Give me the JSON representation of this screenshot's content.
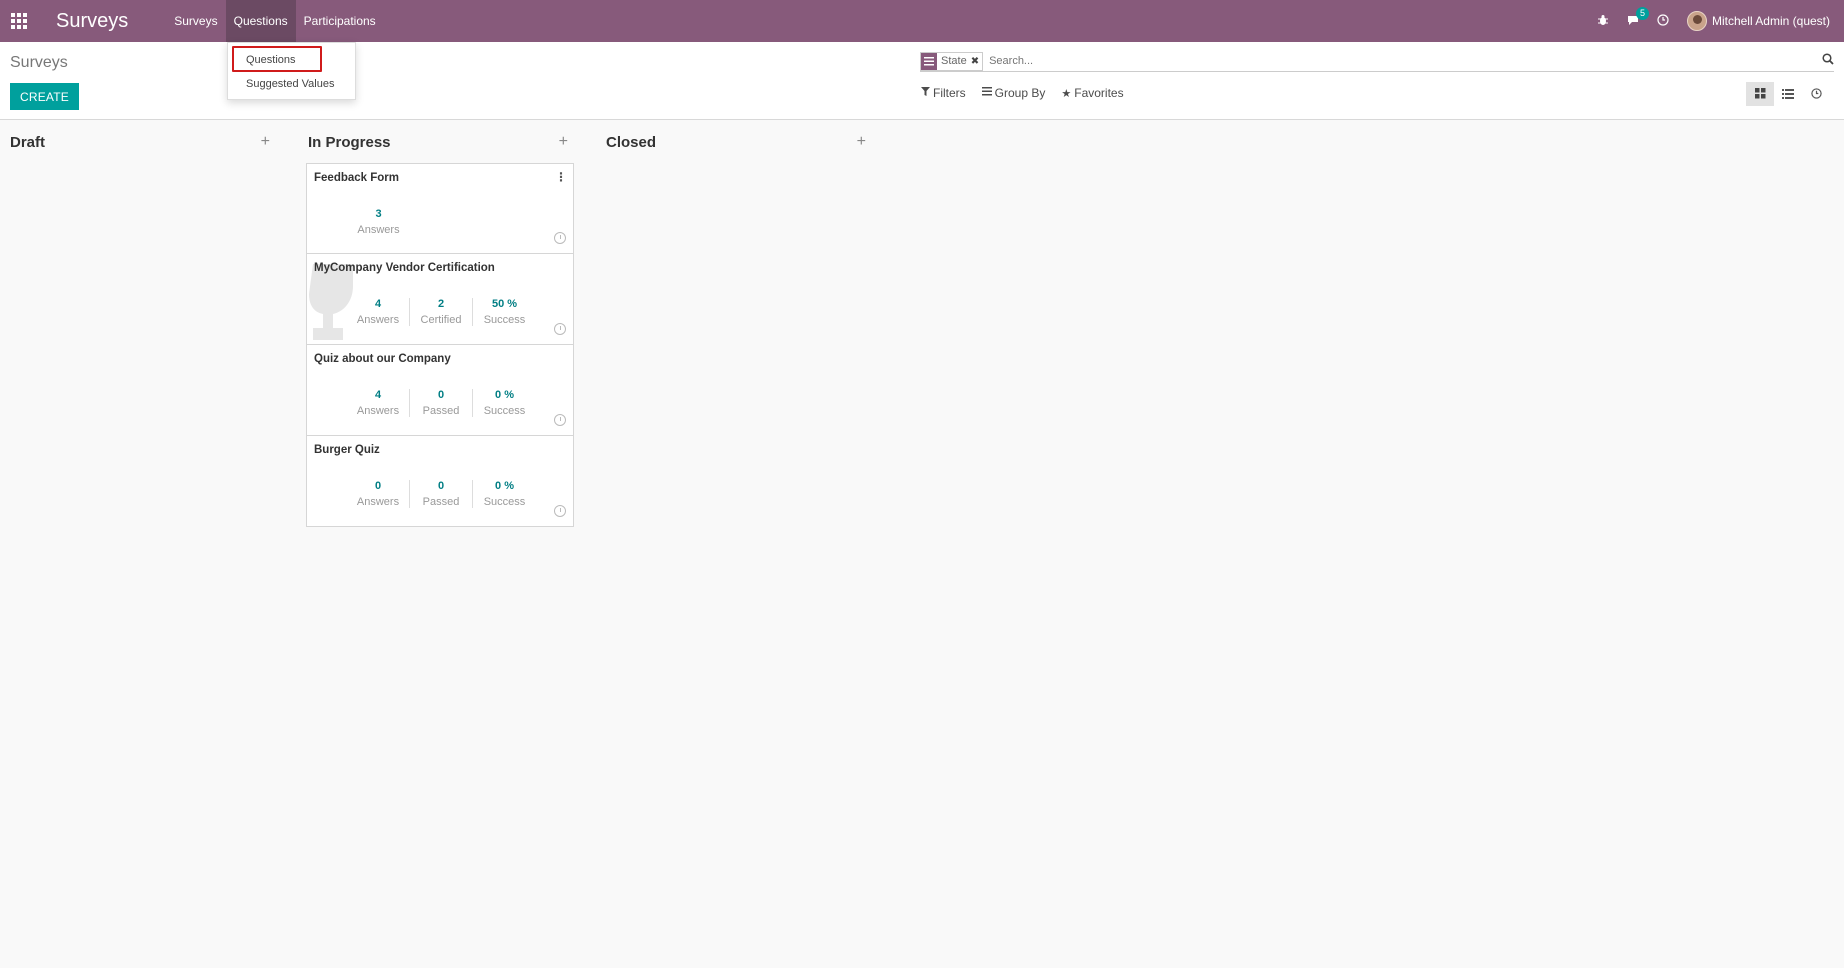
{
  "navbar": {
    "brand": "Surveys",
    "menu": [
      "Surveys",
      "Questions",
      "Participations"
    ],
    "active_menu": "Questions",
    "messages_count": "5",
    "user_name": "Mitchell Admin (quest)"
  },
  "dropdown": {
    "items": [
      "Questions",
      "Suggested Values"
    ],
    "highlighted": "Questions"
  },
  "control_panel": {
    "breadcrumb": "Surveys",
    "create_label": "CREATE",
    "search_facet": "State",
    "search_placeholder": "Search...",
    "filters_label": "Filters",
    "group_by_label": "Group By",
    "favorites_label": "Favorites"
  },
  "kanban": {
    "columns": [
      {
        "title": "Draft",
        "cards": []
      },
      {
        "title": "In Progress",
        "cards": [
          {
            "title": "Feedback Form",
            "stats": [
              {
                "value": "3",
                "label": "Answers"
              }
            ]
          },
          {
            "title": "MyCompany Vendor Certification",
            "stats": [
              {
                "value": "4",
                "label": "Answers"
              },
              {
                "value": "2",
                "label": "Certified"
              },
              {
                "value": "50 %",
                "label": "Success"
              }
            ]
          },
          {
            "title": "Quiz about our Company",
            "stats": [
              {
                "value": "4",
                "label": "Answers"
              },
              {
                "value": "0",
                "label": "Passed"
              },
              {
                "value": "0 %",
                "label": "Success"
              }
            ]
          },
          {
            "title": "Burger Quiz",
            "stats": [
              {
                "value": "0",
                "label": "Answers"
              },
              {
                "value": "0",
                "label": "Passed"
              },
              {
                "value": "0 %",
                "label": "Success"
              }
            ]
          }
        ]
      },
      {
        "title": "Closed",
        "cards": []
      }
    ]
  },
  "colors": {
    "navbar": "#875a7b",
    "accent": "#00a09d",
    "stat_value": "#017e84",
    "highlight": "#d01b1b"
  }
}
